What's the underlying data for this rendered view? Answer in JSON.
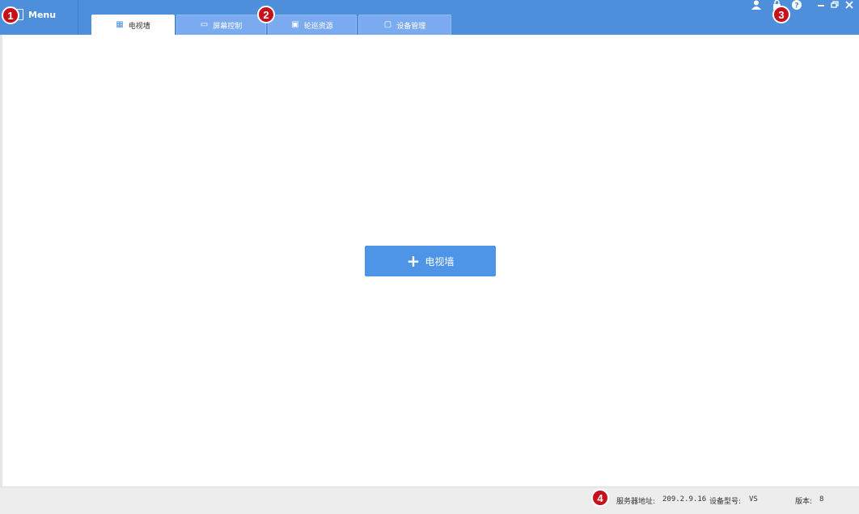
{
  "header": {
    "menu_label": "Menu",
    "tabs": [
      {
        "label": "电视墙",
        "icon": "tv-wall-icon",
        "active": true
      },
      {
        "label": "屏幕控制",
        "icon": "screen-control-icon",
        "active": false
      },
      {
        "label": "轮巡资源",
        "icon": "patrol-resource-icon",
        "active": false
      },
      {
        "label": "设备管理",
        "icon": "device-management-icon",
        "active": false
      }
    ],
    "right_icons": [
      "user-icon",
      "lock-icon",
      "help-icon",
      "minimize-icon",
      "restore-icon",
      "close-icon"
    ]
  },
  "callouts": [
    "1",
    "2",
    "3",
    "4"
  ],
  "main": {
    "add_button_label": "电视墙",
    "add_button_icon": "plus-icon"
  },
  "status": {
    "server_label": "服务器地址:",
    "server_value": "209.2.9.16",
    "model_label": "设备型号:",
    "model_value": "VS",
    "version_label": "版本:",
    "version_value": "8"
  },
  "colors": {
    "header_blue": "#4e8fdc",
    "tab_inactive": "#7aaaf0",
    "button_blue": "#4e95e8",
    "badge_red": "#c8101a",
    "status_bg": "#ededed"
  }
}
